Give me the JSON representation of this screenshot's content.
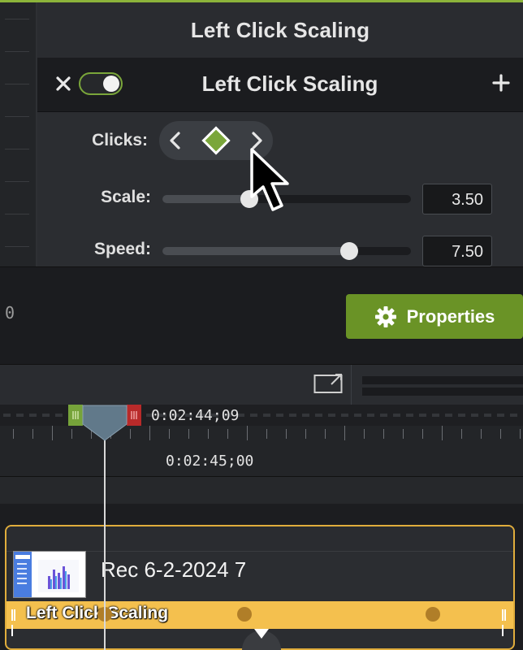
{
  "panel": {
    "title": "Left Click Scaling",
    "effect_name": "Left Click Scaling",
    "effect_enabled": true,
    "close_icon": "close-icon",
    "add_icon": "plus-icon"
  },
  "settings": {
    "clicks_label": "Clicks:",
    "scale_label": "Scale:",
    "scale_value": "3.50",
    "scale_fraction": 0.35,
    "speed_label": "Speed:",
    "speed_value": "7.50",
    "speed_fraction": 0.75
  },
  "canvas_strip": {
    "zero_text": "0",
    "properties_label": "Properties"
  },
  "timeline": {
    "selection_time": "0:02:44;09",
    "ruler_time": "0:02:45;00",
    "clip": {
      "name": "Rec 6-2-2024 7",
      "effect_label": "Left Click Scaling"
    }
  },
  "colors": {
    "accent_green": "#6a9326",
    "toggle_green": "#7aa63a",
    "effect_gold": "#f4c04e",
    "clip_border": "#e0ad3c",
    "mark_in": "#76a33a",
    "mark_out": "#b82a2a"
  }
}
